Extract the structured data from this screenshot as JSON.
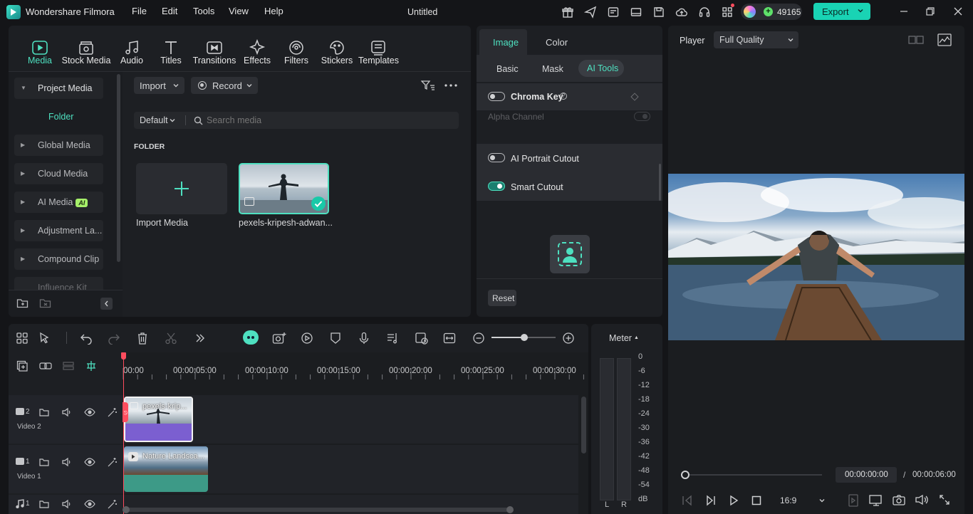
{
  "app": {
    "title": "Wondershare Filmora",
    "document_title": "Untitled",
    "credits": "49165",
    "export_label": "Export"
  },
  "menu": [
    "File",
    "Edit",
    "Tools",
    "View",
    "Help"
  ],
  "media_tabs": [
    "Media",
    "Stock Media",
    "Audio",
    "Titles",
    "Transitions",
    "Effects",
    "Filters",
    "Stickers",
    "Templates"
  ],
  "sidebar": {
    "project_media": "Project Media",
    "folder": "Folder",
    "items": [
      "Global Media",
      "Cloud Media",
      "AI Media",
      "Adjustment La...",
      "Compound Clip",
      "Influence Kit"
    ],
    "ai_badge": "AI"
  },
  "media": {
    "import_label": "Import",
    "record_label": "Record",
    "sort_label": "Default",
    "search_placeholder": "Search media",
    "folder_heading": "FOLDER",
    "import_media_label": "Import Media",
    "clip_name": "pexels-kripesh-adwan..."
  },
  "properties": {
    "tabs": [
      "Image",
      "Color"
    ],
    "subtabs": [
      "Basic",
      "Mask",
      "AI Tools"
    ],
    "chroma_key": "Chroma Key",
    "alpha_channel": "Alpha Channel",
    "ai_portrait": "AI Portrait Cutout",
    "smart_cutout": "Smart Cutout",
    "reset": "Reset",
    "smart_cutout_on": true
  },
  "player": {
    "label": "Player",
    "quality": "Full Quality",
    "current_time": "00:00:00:00",
    "separator": "/",
    "total_time": "00:00:06:00",
    "aspect": "16:9"
  },
  "timeline": {
    "ruler": [
      "00:00",
      "00:00:05:00",
      "00:00:10:00",
      "00:00:15:00",
      "00:00:20:00",
      "00:00:25:00",
      "00:00:30:00"
    ],
    "tracks": [
      {
        "number": "2",
        "name": "Video 2",
        "clip": "pexels-krip..."
      },
      {
        "number": "1",
        "name": "Video 1",
        "clip": "Nature Landsca..."
      },
      {
        "number": "1",
        "name": "",
        "clip": ""
      }
    ]
  },
  "meter": {
    "label": "Meter",
    "scale": [
      "0",
      "-6",
      "-12",
      "-18",
      "-24",
      "-30",
      "-36",
      "-42",
      "-48",
      "-54",
      "dB"
    ],
    "left": "L",
    "right": "R"
  },
  "colors": {
    "accent": "#4ee0c0",
    "export_bg": "#19d3b4",
    "playhead": "#ff4d5e",
    "clip_purple": "#7b5fd0",
    "clip_teal": "#3d9a87"
  }
}
